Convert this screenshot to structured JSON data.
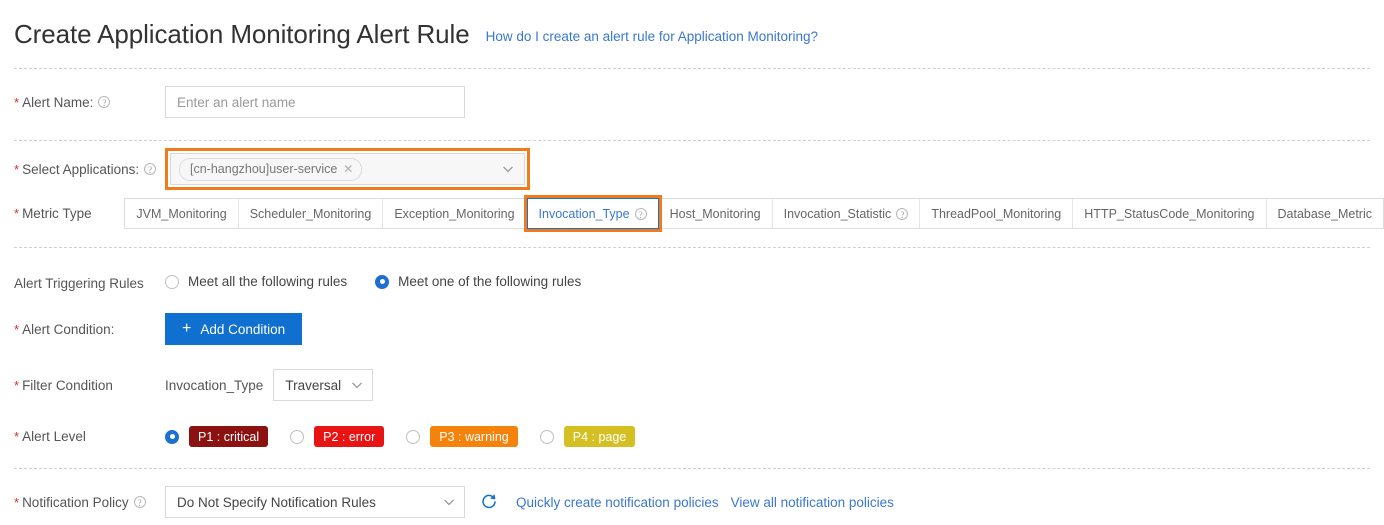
{
  "header": {
    "title": "Create Application Monitoring Alert Rule",
    "help_link": "How do I create an alert rule for Application Monitoring?"
  },
  "form": {
    "alert_name": {
      "label": "Alert Name:",
      "required": true,
      "value": "",
      "placeholder": "Enter an alert name",
      "help_icon": "question-circle-icon"
    },
    "select_applications": {
      "label": "Select Applications:",
      "required": true,
      "tag": "[cn-hangzhou]user-service",
      "tag_remove_icon": "close-icon",
      "caret_icon": "chevron-down-icon",
      "highlighted": true,
      "highlight_color": "#ef7b1c"
    },
    "metric_type": {
      "label": "Metric Type",
      "required": true,
      "active_index": 3,
      "tabs": [
        {
          "label": "JVM_Monitoring",
          "has_help": false
        },
        {
          "label": "Scheduler_Monitoring",
          "has_help": false
        },
        {
          "label": "Exception_Monitoring",
          "has_help": false
        },
        {
          "label": "Invocation_Type",
          "has_help": true
        },
        {
          "label": "Host_Monitoring",
          "has_help": false
        },
        {
          "label": "Invocation_Statistic",
          "has_help": true
        },
        {
          "label": "ThreadPool_Monitoring",
          "has_help": false
        },
        {
          "label": "HTTP_StatusCode_Monitoring",
          "has_help": false
        },
        {
          "label": "Database_Metric",
          "has_help": false
        }
      ]
    },
    "alert_triggering_rules": {
      "label": "Alert Triggering Rules",
      "required": false,
      "selected_index": 1,
      "options": [
        {
          "label": "Meet all the following rules"
        },
        {
          "label": "Meet one of the following rules"
        }
      ]
    },
    "alert_condition": {
      "label": "Alert Condition:",
      "required": true,
      "button_label": "Add Condition",
      "button_icon": "plus-icon"
    },
    "filter_condition": {
      "label": "Filter Condition",
      "required": true,
      "field_label": "Invocation_Type",
      "value": "Traversal",
      "caret_icon": "chevron-down-icon"
    },
    "alert_level": {
      "label": "Alert Level",
      "required": true,
      "selected_index": 0,
      "options": [
        {
          "label": "P1 : critical",
          "color": "#8c1212"
        },
        {
          "label": "P2 : error",
          "color": "#e81313"
        },
        {
          "label": "P3 : warning",
          "color": "#f5820b"
        },
        {
          "label": "P4 : page",
          "color": "#d4c022"
        }
      ]
    },
    "notification_policy": {
      "label": "Notification Policy",
      "required": true,
      "value": "Do Not Specify Notification Rules",
      "caret_icon": "chevron-down-icon",
      "refresh_icon": "refresh-icon",
      "links": [
        {
          "label": "Quickly create notification policies"
        },
        {
          "label": "View all notification policies"
        }
      ]
    }
  }
}
